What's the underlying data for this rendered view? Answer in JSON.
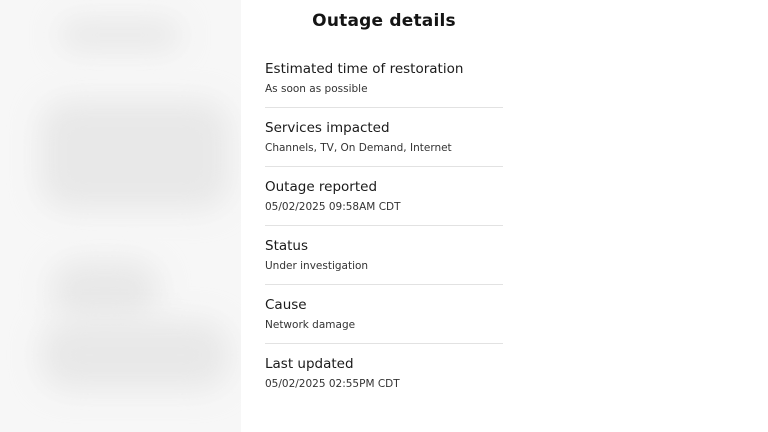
{
  "modal": {
    "title": "Outage details",
    "details": [
      {
        "label": "Estimated time of restoration",
        "value": "As soon as possible"
      },
      {
        "label": "Services impacted",
        "value": "Channels, TV, On Demand, Internet"
      },
      {
        "label": "Outage reported",
        "value": "05/02/2025 09:58AM CDT"
      },
      {
        "label": "Status",
        "value": "Under investigation"
      },
      {
        "label": "Cause",
        "value": "Network damage"
      },
      {
        "label": "Last updated",
        "value": "05/02/2025 02:55PM CDT"
      }
    ]
  },
  "colors": {
    "background": "#ffffff",
    "text": "#1a1a1a",
    "divider": "#e2e2e2"
  }
}
